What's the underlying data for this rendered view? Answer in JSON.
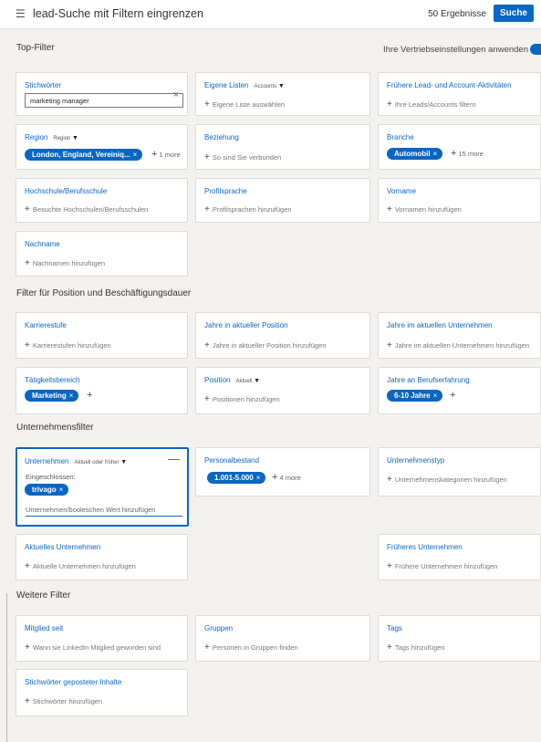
{
  "header": {
    "title": "lead-Suche mit Filtern eingrenzen",
    "results": "50 Ergebnisse",
    "search_button": "Suche"
  },
  "sections": {
    "top": "Top-Filter",
    "position": "Filter für Position und Beschäftigungsdauer",
    "company": "Unternehmensfilter",
    "more": "Weitere Filter"
  },
  "toggle": {
    "label": "Ihre Vertriebseinstellungen anwenden",
    "on": true
  },
  "filters": {
    "stichwoerter": {
      "title": "Stichwörter",
      "value": "marketing manager",
      "clear": "×"
    },
    "eigene_listen": {
      "title": "Eigene Listen",
      "dropdown": "Accounts",
      "add": "Eigene Liste auswählen"
    },
    "fruehere_aktivitaeten": {
      "title": "Frühere Lead- und Account-Aktivitäten",
      "add": "Ihre Leads/Accounts filtern"
    },
    "region": {
      "title": "Region",
      "dropdown": "Region",
      "chip": "London, England, Vereiniq...",
      "more": "1 more"
    },
    "beziehung": {
      "title": "Beziehung",
      "add": "So sind Sie verbunden"
    },
    "branche": {
      "title": "Branche",
      "chip": "Automobil",
      "more": "15 more"
    },
    "hochschule": {
      "title": "Hochschule/Berufsschule",
      "add": "Besuchte Hochschulen/Berufsschulen"
    },
    "profilsprache": {
      "title": "Profilsprache",
      "add": "Profilsprachen hinzufügen"
    },
    "vorname": {
      "title": "Vorname",
      "add": "Vornamen hinzufügen"
    },
    "nachname": {
      "title": "Nachname",
      "add": "Nachnamen hinzufügen"
    },
    "karrierestufe": {
      "title": "Karrierestufe",
      "add": "Karrierestufen hinzufügen"
    },
    "jahre_position": {
      "title": "Jahre in aktueller Position",
      "add": "Jahre in aktueller Position hinzufügen"
    },
    "jahre_unternehmen": {
      "title": "Jahre im aktuellen Unternehmen",
      "add": "Jahre im aktuellen Unternehmen hinzufügen"
    },
    "taetigkeitsbereich": {
      "title": "Tätigkeitsbereich",
      "chip": "Marketing"
    },
    "position": {
      "title": "Position",
      "dropdown": "Aktuell",
      "add": "Positionen hinzufügen"
    },
    "berufserfahrung": {
      "title": "Jahre an Berufserfahrung",
      "chip": "6-10 Jahre"
    },
    "unternehmen": {
      "title": "Unternehmen",
      "dropdown": "Aktuell oder früher",
      "included_label": "Eingeschlossen:",
      "chip": "trivago",
      "placeholder": "Unternehmen/booleschen Wert hinzufügen",
      "collapse": "—"
    },
    "personalbestand": {
      "title": "Personalbestand",
      "chip": "1.001-5.000",
      "more": "4 more"
    },
    "unternehmenstyp": {
      "title": "Unternehmenstyp",
      "add": "Unternehmenskategorien hinzufügen"
    },
    "aktuelles_unternehmen": {
      "title": "Aktuelles Unternehmen",
      "add": "Aktuelle Unternehmen hinzufügen"
    },
    "frueheres_unternehmen": {
      "title": "Früheres Unternehmen",
      "add": "Frühere Unternehmen hinzufügen"
    },
    "mitglied_seit": {
      "title": "Mitglied seit",
      "add": "Wann sie LinkedIn Mitglied geworden sind"
    },
    "gruppen": {
      "title": "Gruppen",
      "add": "Personen in Gruppen finden"
    },
    "tags": {
      "title": "Tags",
      "add": "Tags hinzufügen"
    },
    "stichwoerter_inhalte": {
      "title": "Stichwörter geposteter Inhalte",
      "add": "Stichwörter hinzufügen"
    }
  },
  "symbols": {
    "plus": "+",
    "chip_remove": "×",
    "caret": "▼"
  },
  "icons": {
    "filter": "sliders-icon"
  },
  "colors": {
    "accent": "#0a66c2"
  }
}
